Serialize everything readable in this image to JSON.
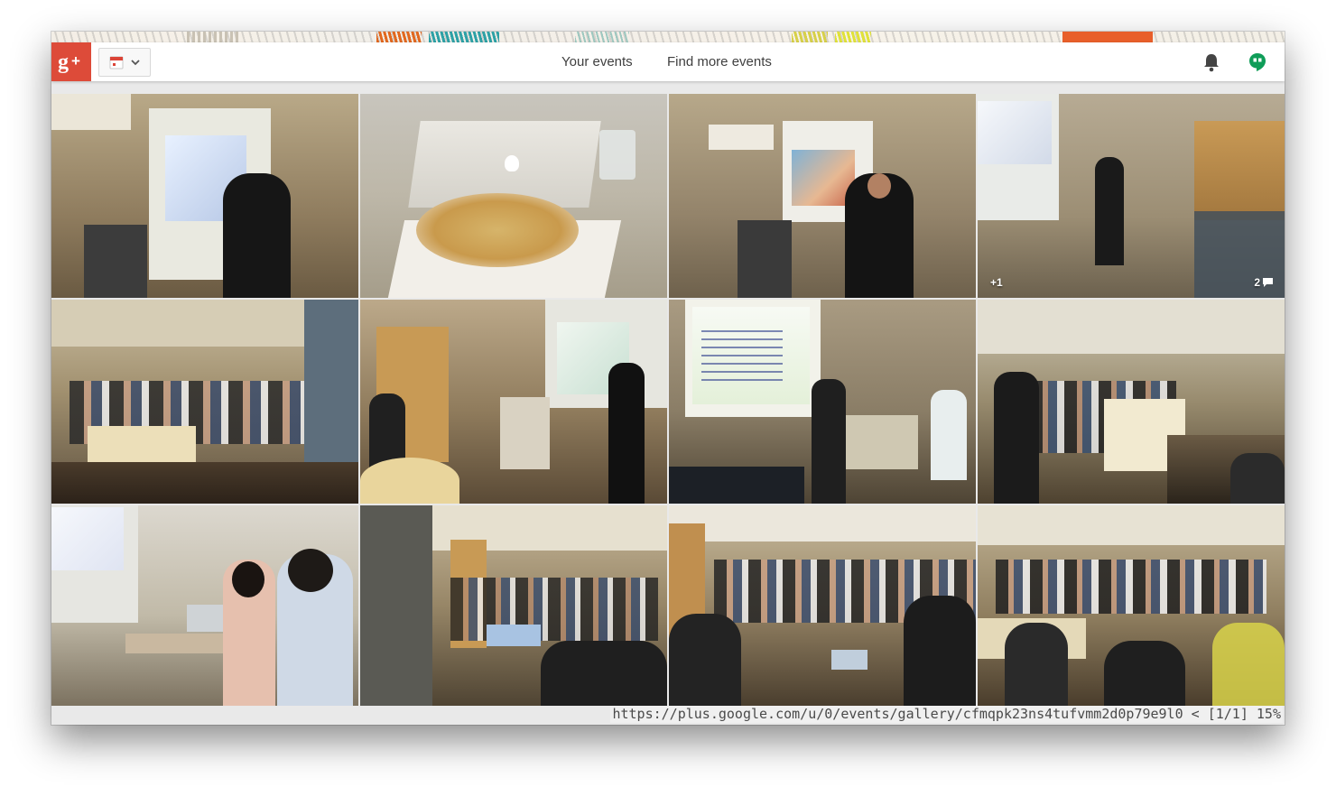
{
  "app": {
    "logo_text": "g+",
    "brand_color": "#dd4b39"
  },
  "header": {
    "app_switcher_icon": "calendar-icon",
    "nav": [
      {
        "label": "Your events"
      },
      {
        "label": "Find more events"
      }
    ],
    "notifications_icon": "bell-icon",
    "hangouts_icon": "hangouts-icon",
    "hangouts_color": "#0f9d58"
  },
  "gallery": {
    "photos": [
      {
        "subject": "presenter-at-screen",
        "overlay_left": "",
        "overlay_right": ""
      },
      {
        "subject": "food-and-laptop",
        "overlay_left": "",
        "overlay_right": ""
      },
      {
        "subject": "speaker-with-mic",
        "overlay_left": "",
        "overlay_right": ""
      },
      {
        "subject": "speaker-wide-room",
        "overlay_left": "+1",
        "overlay_right": "2"
      },
      {
        "subject": "audience-room",
        "overlay_left": "",
        "overlay_right": ""
      },
      {
        "subject": "presenter-code-slide",
        "overlay_left": "",
        "overlay_right": ""
      },
      {
        "subject": "code-slide-close",
        "overlay_left": "",
        "overlay_right": ""
      },
      {
        "subject": "audience-steps",
        "overlay_left": "",
        "overlay_right": ""
      },
      {
        "subject": "female-speaker",
        "overlay_left": "",
        "overlay_right": ""
      },
      {
        "subject": "audience-laptops",
        "overlay_left": "",
        "overlay_right": ""
      },
      {
        "subject": "audience-center",
        "overlay_left": "",
        "overlay_right": ""
      },
      {
        "subject": "audience-closeup",
        "overlay_left": "",
        "overlay_right": ""
      }
    ]
  },
  "status": {
    "text": "https://plus.google.com/u/0/events/gallery/cfmqpk23ns4tufvmm2d0p79e9l0 < [1/1] 15%"
  }
}
